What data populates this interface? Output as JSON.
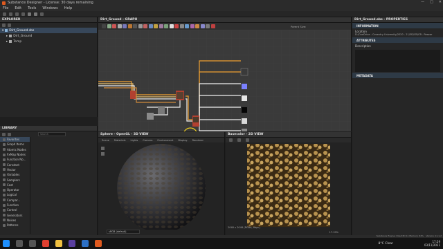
{
  "titlebar": {
    "title": "Substance Designer - License: 30 days remaining"
  },
  "menu": [
    "File",
    "Edit",
    "Tools",
    "Windows",
    "Help"
  ],
  "explorer": {
    "title": "EXPLORER",
    "items": [
      {
        "label": "Dirt_Ground.sbs"
      },
      {
        "label": "Dirt_Ground"
      },
      {
        "label": "Temp"
      }
    ]
  },
  "graph": {
    "title": "Dirt_Ground - GRAPH",
    "parent_size_label": "Parent Size:"
  },
  "properties": {
    "title": "Dirt_Ground.sbs - PROPERTIES",
    "sections": {
      "information": "INFORMATION",
      "attributes": "ATTRIBUTES",
      "metadata": "METADATA"
    },
    "location_label": "Location",
    "location_value": "D:/OneDrive - Coventry University/2020 - 21/3D/CB/CB - Resear",
    "description_label": "Description"
  },
  "library": {
    "title": "LIBRARY",
    "search_placeholder": "Search",
    "categories": [
      {
        "label": "Favorites",
        "icon": "star-icon"
      },
      {
        "label": "Graph Items",
        "icon": "graph-icon"
      },
      {
        "label": "Atomic Nodes",
        "icon": "atom-icon"
      },
      {
        "label": "FxMap Nodes",
        "icon": "fxmap-icon"
      },
      {
        "label": "Function No...",
        "icon": "function-icon"
      },
      {
        "label": "Constant",
        "icon": "constant-icon"
      },
      {
        "label": "Vector",
        "icon": "vector-icon"
      },
      {
        "label": "Variables",
        "icon": "variables-icon"
      },
      {
        "label": "Samplers",
        "icon": "samplers-icon"
      },
      {
        "label": "Cast",
        "icon": "cast-icon"
      },
      {
        "label": "Operator",
        "icon": "operator-icon"
      },
      {
        "label": "Logical",
        "icon": "logical-icon"
      },
      {
        "label": "Compar...",
        "icon": "compare-icon"
      },
      {
        "label": "Function",
        "icon": "function-icon"
      },
      {
        "label": "Control",
        "icon": "control-icon"
      },
      {
        "label": "Generators",
        "icon": "generators-icon"
      },
      {
        "label": "Noises",
        "icon": "noises-icon"
      },
      {
        "label": "Patterns",
        "icon": "patterns-icon"
      }
    ]
  },
  "view3d": {
    "title": "Sphere - OpenGL - 3D VIEW",
    "menu": [
      "Scene",
      "Materials",
      "Lights",
      "Camera",
      "Environment",
      "Display",
      "Renderer"
    ],
    "colorspace": "sRGB (default)"
  },
  "view2d": {
    "title": "Basecolor - 2D VIEW",
    "info": "2048 x 2048 (RGBA, 8bpc)",
    "zoom": "17.19%"
  },
  "statusbar": {
    "engine": "Substance Engine: Direct3D 11  Memory: 64%",
    "version": "Version: 11.1.2"
  },
  "taskbar": {
    "weather": "8°C  Clear",
    "time": "17:29",
    "date": "03/11/2021"
  },
  "colors": {
    "accent": "#e05a1f",
    "selection": "#37475a",
    "wire": "#f0a030"
  }
}
